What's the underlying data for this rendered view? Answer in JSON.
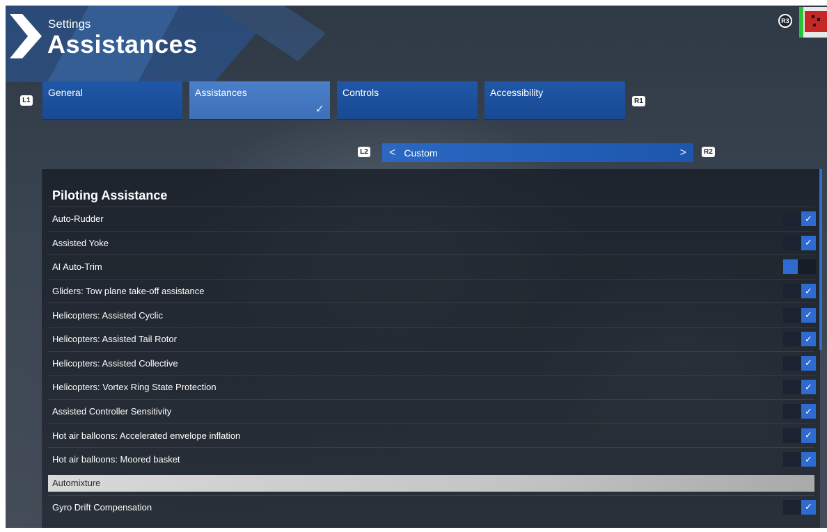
{
  "header": {
    "breadcrumb": "Settings",
    "title": "Assistances",
    "right_badge": "R3"
  },
  "tabs": {
    "left_badge": "L1",
    "right_badge": "R1",
    "items": [
      {
        "label": "General",
        "active": false
      },
      {
        "label": "Assistances",
        "active": true
      },
      {
        "label": "Controls",
        "active": false
      },
      {
        "label": "Accessibility",
        "active": false
      }
    ]
  },
  "preset": {
    "left_badge": "L2",
    "right_badge": "R2",
    "value": "Custom",
    "prev_icon": "chevron-left-icon",
    "next_icon": "chevron-right-icon"
  },
  "section": {
    "title": "Piloting Assistance",
    "rows": [
      {
        "label": "Auto-Rudder",
        "checked": true
      },
      {
        "label": "Assisted Yoke",
        "checked": true
      },
      {
        "label": "AI Auto-Trim",
        "checked": false
      },
      {
        "label": "Gliders: Tow plane take-off assistance",
        "checked": true
      },
      {
        "label": "Helicopters: Assisted Cyclic",
        "checked": true
      },
      {
        "label": "Helicopters: Assisted Tail Rotor",
        "checked": true
      },
      {
        "label": "Helicopters: Assisted Collective",
        "checked": true
      },
      {
        "label": "Helicopters: Vortex Ring State Protection",
        "checked": true
      },
      {
        "label": "Assisted Controller Sensitivity",
        "checked": true
      },
      {
        "label": "Hot air balloons: Accelerated envelope inflation",
        "checked": true
      },
      {
        "label": "Hot air balloons: Moored basket",
        "checked": true
      },
      {
        "label": "Automixture",
        "checked": true,
        "focused": true
      },
      {
        "label": "Gyro Drift Compensation",
        "checked": true
      }
    ]
  },
  "colors": {
    "accent": "#2e6bd0",
    "tab": "#1f57a8",
    "tab_active": "#4a7fc9"
  }
}
